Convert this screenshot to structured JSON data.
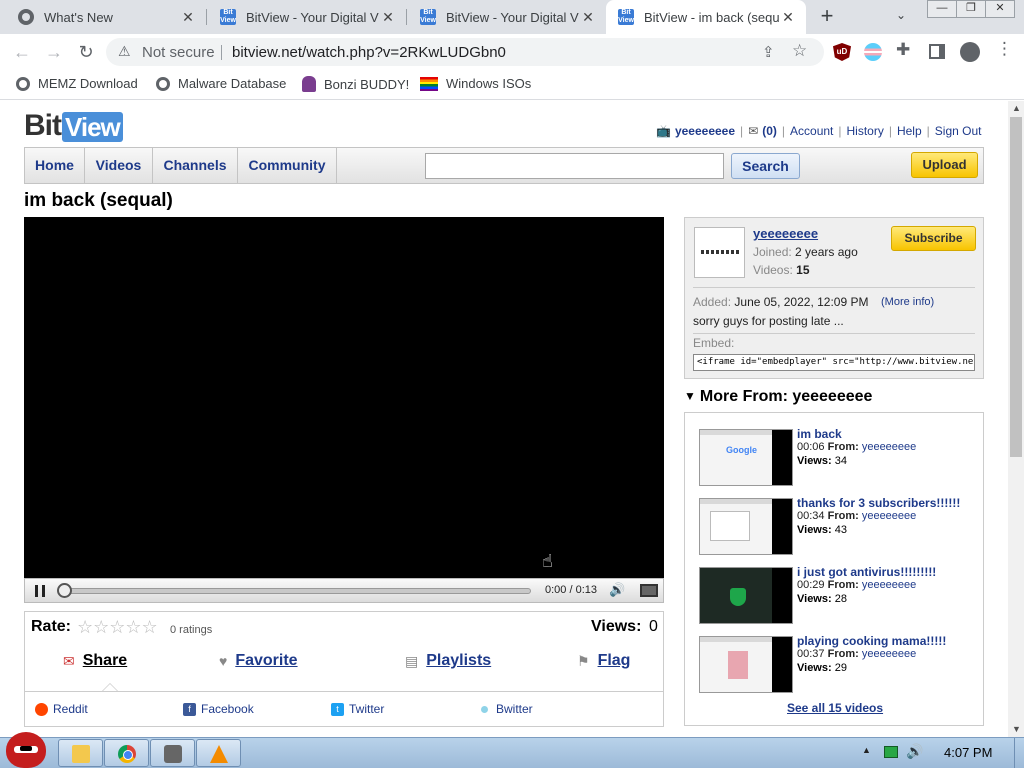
{
  "browser": {
    "tabs": [
      {
        "title": "What's New",
        "icon": "chrome-globe-icon",
        "active": false
      },
      {
        "title": "BitView - Your Digital V",
        "icon": "bitview-favicon",
        "active": false
      },
      {
        "title": "BitView - Your Digital V",
        "icon": "bitview-favicon",
        "active": false
      },
      {
        "title": "BitView - im back (sequ",
        "icon": "bitview-favicon",
        "active": true
      }
    ],
    "tab_close": "✕",
    "new_tab": "+",
    "tab_search": "⌄",
    "window_buttons": [
      "—",
      "❐",
      "✕"
    ],
    "security_label": "Not secure",
    "url": "bitview.net/watch.php?v=2RKwLUDGbn0",
    "bookmarks": [
      {
        "label": "MEMZ Download",
        "icon": "globe-icon"
      },
      {
        "label": "Malware Database",
        "icon": "globe-icon"
      },
      {
        "label": "Bonzi BUDDY!",
        "icon": "bonzi-icon"
      },
      {
        "label": "Windows ISOs",
        "icon": "rainbow-flag-icon"
      }
    ],
    "ublock_badge": "uD"
  },
  "site": {
    "logo_bit": "Bit",
    "logo_view": "View",
    "username": "yeeeeeeee",
    "inbox_count": "(0)",
    "links": [
      "Account",
      "History",
      "Help",
      "Sign Out"
    ],
    "nav": [
      "Home",
      "Videos",
      "Channels",
      "Community"
    ],
    "search_value": "",
    "search_button": "Search",
    "upload_button": "Upload"
  },
  "video": {
    "title": "im back (sequal)",
    "time": "0:00 / 0:13",
    "progress": 0.0,
    "rate_label": "Rate:",
    "stars": "☆☆☆☆☆",
    "ratings": "0 ratings",
    "views_label": "Views:",
    "views": "0",
    "actions": [
      "Share",
      "Favorite",
      "Playlists",
      "Flag"
    ],
    "share_targets": [
      "Reddit",
      "Facebook",
      "Twitter",
      "Bwitter"
    ]
  },
  "channel": {
    "name": "yeeeeeeee",
    "joined_label": "Joined:",
    "joined": "2 years ago",
    "videos_label": "Videos:",
    "videos": "15",
    "subscribe": "Subscribe",
    "added_label": "Added:",
    "added": "June 05, 2022, 12:09 PM",
    "more_info": "(More info)",
    "description": "sorry guys for posting late ...",
    "embed_label": "Embed:",
    "embed_code": "<iframe id=\"embedplayer\" src=\"http://www.bitview.net/embed.php"
  },
  "more_from": {
    "header": "More From: yeeeeeeee",
    "from_label": "From:",
    "views_label": "Views:",
    "items": [
      {
        "title": "im back",
        "duration": "00:06",
        "author": "yeeeeeeee",
        "views": "34"
      },
      {
        "title": "thanks for 3 subscribers!!!!!!",
        "duration": "00:34",
        "author": "yeeeeeeee",
        "views": "43"
      },
      {
        "title": "i just got antivirus!!!!!!!!!",
        "duration": "00:29",
        "author": "yeeeeeeee",
        "views": "28"
      },
      {
        "title": "playing cooking mama!!!!!",
        "duration": "00:37",
        "author": "yeeeeeeee",
        "views": "29"
      }
    ],
    "see_all": "See all 15 videos"
  },
  "taskbar": {
    "clock": "4:07 PM"
  },
  "colors": {
    "link": "#1e3a8a",
    "subscribe_yellow": "#f8c400",
    "chrome_tabstrip": "#dee1e6"
  }
}
